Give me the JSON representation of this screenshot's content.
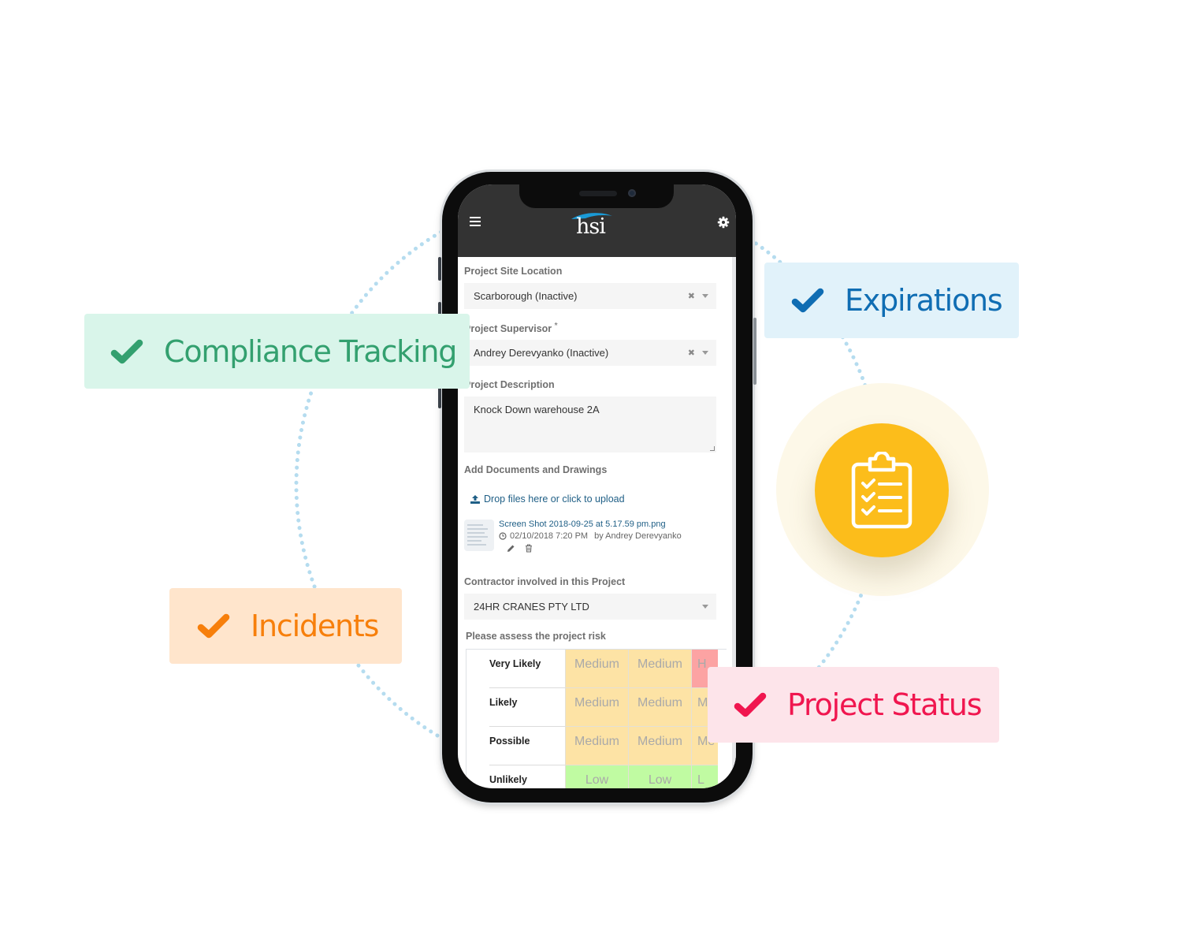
{
  "app": {
    "brand": "hsi",
    "header_icons": [
      "hamburger-menu-icon",
      "gear-icon"
    ]
  },
  "form": {
    "site_location": {
      "label": "Project Site Location",
      "value": "Scarborough (Inactive)",
      "clear_glyph": "✖"
    },
    "supervisor": {
      "label": "Project Supervisor",
      "required_mark": "*",
      "value": "Andrey Derevyanko (Inactive)",
      "clear_glyph": "✖"
    },
    "description": {
      "label": "Project Description",
      "value": "Knock Down warehouse 2A"
    },
    "documents": {
      "label": "Add Documents and Drawings",
      "upload_label": "Drop files here or click to upload",
      "files": [
        {
          "name": "Screen Shot 2018-09-25 at 5.17.59 pm.png",
          "date": "02/10/2018 7:20 PM",
          "by": "by Andrey Derevyanko"
        }
      ]
    },
    "contractor": {
      "label": "Contractor involved in this Project",
      "value": "24HR CRANES PTY LTD"
    },
    "risk": {
      "label": "Please assess the project risk",
      "rows": [
        {
          "label": "Very Likely",
          "cells": [
            "Medium",
            "Medium",
            "H"
          ],
          "levels": [
            "med",
            "med",
            "high"
          ]
        },
        {
          "label": "Likely",
          "cells": [
            "Medium",
            "Medium",
            "M"
          ],
          "levels": [
            "med",
            "med",
            "med"
          ]
        },
        {
          "label": "Possible",
          "cells": [
            "Medium",
            "Medium",
            "Me"
          ],
          "levels": [
            "med",
            "med",
            "med"
          ]
        },
        {
          "label": "Unlikely",
          "cells": [
            "Low",
            "Low",
            "L"
          ],
          "levels": [
            "low",
            "low",
            "low"
          ]
        }
      ]
    }
  },
  "features": [
    {
      "label": "Compliance Tracking",
      "color": "#33a06f",
      "bg": "#d9f5ea"
    },
    {
      "label": "Expirations",
      "color": "#0f6db3",
      "bg": "#e1f2fa"
    },
    {
      "label": "Incidents",
      "color": "#f77f0b",
      "bg": "#ffe5cc"
    },
    {
      "label": "Project Status",
      "color": "#f0164f",
      "bg": "#fde4ea"
    }
  ],
  "center_icon": "clipboard-checklist-icon",
  "colors": {
    "appbar": "#333333",
    "accent_yellow": "#fcbd1b",
    "link": "#1f5f86",
    "ring_dots": "#b5dcef"
  }
}
